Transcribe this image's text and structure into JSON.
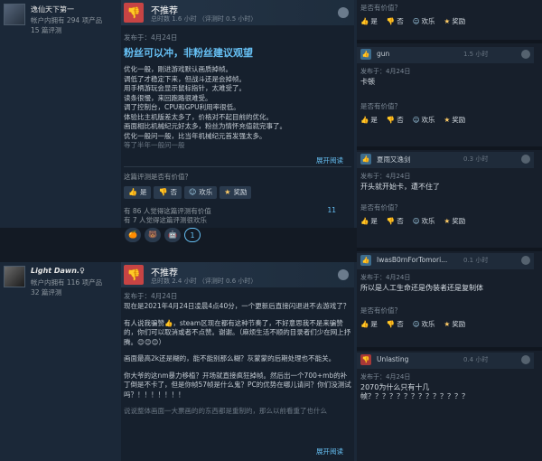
{
  "reviews": [
    {
      "author_name": "逸仙天下第一",
      "author_products": "帐户内拥有 294 项产品",
      "author_reviews": "15 篇评测",
      "verdict": "不推荐",
      "hours": "总时数 1.6 小时 （评测时 0.5 小时）",
      "posted": "发布于：4月24日",
      "headline": "粉丝可以冲，非粉丝建议观望",
      "body_lines": [
        "优化一般，刚进游戏默认画质掉帧。",
        "调低了才稳定下来，但战斗还是会掉帧。",
        "用手柄游玩会显示鼠标指针，太难受了。",
        "读条很慢，来回跑路很难受。",
        "调了控制台，CPU和GPU利用率很低。",
        "体验比主机版差太多了，价格对不起目前的优化。",
        "画面相比机械纪元好太多，粉丝为情怀充值就完事了。",
        "优化一般问一般，比当年机械纪元首发强太多。",
        "等了半年一般问一般"
      ],
      "read_more": "展开阅读",
      "helpful_question": "这篇评测是否有价值？",
      "btn_yes": "是",
      "btn_no": "否",
      "btn_funny": "欢乐",
      "btn_award": "奖励",
      "stat_helpful": "有 86 人觉得这篇评测有价值",
      "stat_funny": "有 7 人觉得这篇评测很欢乐",
      "comment_count": "11",
      "awards": [
        "🍊",
        "🐻",
        "🤖",
        "1"
      ]
    },
    {
      "author_name": "Light Dawn.♀",
      "author_products": "帐户内拥有 116 项产品",
      "author_reviews": "32 篇评测",
      "verdict": "不推荐",
      "hours": "总时数 2.4 小时 （评测时 0.6 小时）",
      "posted": "发布于：4月24日",
      "paragraphs": [
        "现在是2021年4月24日凌晨4点40分，一个更新后直接闪退进不去游戏了？",
        "有人说我骗赞👍，steam区现在都有这种节奏了，不好意思我不是来骗赞的，你们可以取消或者不点赞。谢谢。（麻烦生活不顺的目录者们少在网上抒腾。😊😊😊）",
        "画面最高2k还是糊的，能不能别那么糊？灰蒙蒙的后期处理也不能关。",
        "你大爷的这nm暴力移植？开场就直接疯狂掉帧。然后出一个700+mb的补丁倒是不卡了，但是你帧57帧是什么鬼？PC的优势在哪儿请问？你们没测试吗？！！！！！！！",
        "说说整体画面一大票画的的东西都是重制的，那么以前看重了也什么"
      ],
      "read_more": "展开阅读"
    }
  ],
  "comments": [
    {
      "name": "",
      "hours": "",
      "posted": "",
      "text": "",
      "helpful_question": "是否有价值？",
      "btn_yes": "是",
      "btn_no": "否",
      "btn_funny": "欢乐",
      "btn_award": "奖励"
    },
    {
      "name": "gun",
      "hours": "1.5 小时",
      "posted": "发布于：4月24日",
      "text": "卡顿",
      "helpful_question": "是否有价值？",
      "btn_yes": "是",
      "btn_no": "否",
      "btn_funny": "欢乐",
      "btn_award": "奖励"
    },
    {
      "name": "夏雨又逸剑",
      "hours": "0.3 小时",
      "posted": "发布于：4月24日",
      "text": "开头就开始卡，遭不住了",
      "helpful_question": "是否有价值？",
      "btn_yes": "是",
      "btn_no": "否",
      "btn_funny": "欢乐",
      "btn_award": "奖励"
    },
    {
      "name": "IwasB0rnForTomori...",
      "hours": "0.1 小时",
      "posted": "发布于：4月24日",
      "text": "所以是人工生命还是伪装者还是复制体",
      "helpful_question": "是否有价值？",
      "btn_yes": "是",
      "btn_no": "否",
      "btn_funny": "欢乐",
      "btn_award": "奖励"
    },
    {
      "name": "Unlasting",
      "hours": "0.4 小时",
      "posted": "发布于：4月24日",
      "text": "2070为什么只有十几帧？？？？？？？？？？？？？？"
    }
  ]
}
